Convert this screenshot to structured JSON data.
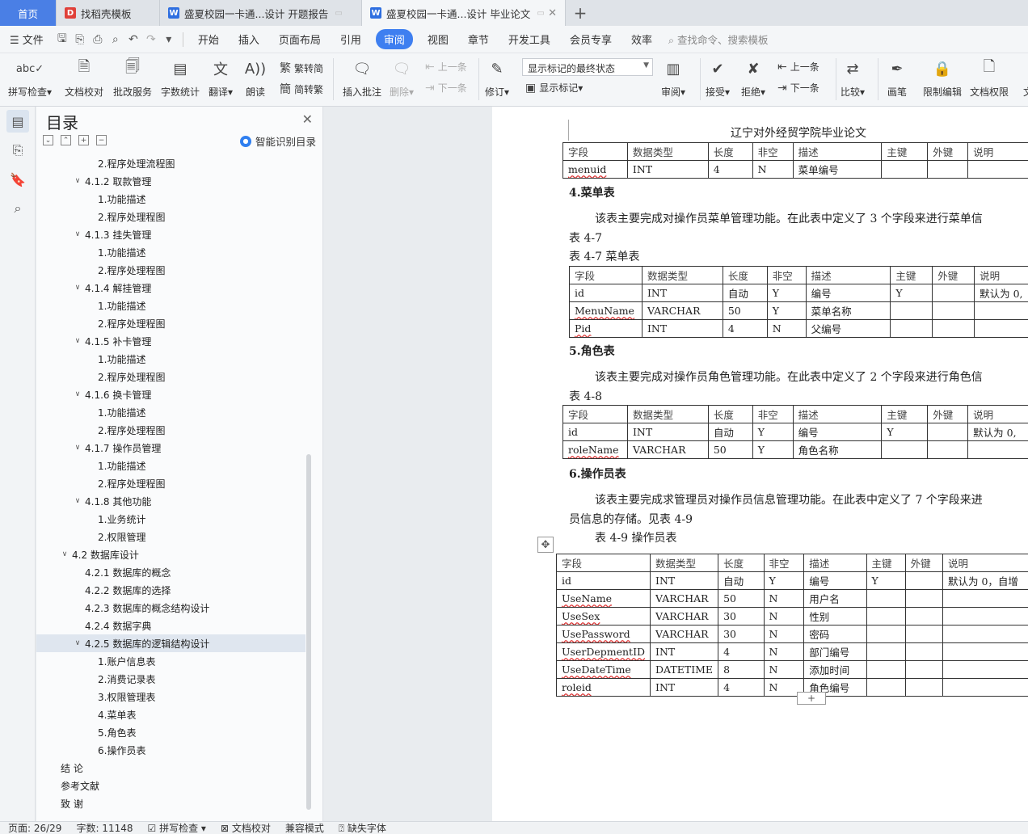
{
  "tabs": {
    "home": "首页",
    "t1": "找稻壳模板",
    "t2": "盛夏校园一卡通...设计 开题报告",
    "t3": "盛夏校园一卡通...设计 毕业论文"
  },
  "menu": {
    "file": "文件",
    "items": [
      "开始",
      "插入",
      "页面布局",
      "引用",
      "审阅",
      "视图",
      "章节",
      "开发工具",
      "会员专享",
      "效率"
    ],
    "search": "查找命令、搜索模板"
  },
  "ribbon": {
    "spell": "拼写检查",
    "doc_check": "文档校对",
    "batch": "批改服务",
    "word_count": "字数统计",
    "translate": "翻译",
    "read": "朗读",
    "trad": "繁转简",
    "simp": "简转繁",
    "insert_comment": "插入批注",
    "delete": "删除",
    "prev": "上一条",
    "next": "下一条",
    "revise": "修订",
    "state": "显示标记的最终状态",
    "show_marks": "显示标记",
    "review": "审阅",
    "accept": "接受",
    "reject": "拒绝",
    "prev2": "上一条",
    "next2": "下一条",
    "compare": "比较",
    "pen": "画笔",
    "restrict": "限制编辑",
    "doc_perm": "文档权限",
    "more": "文"
  },
  "toc": {
    "title": "目录",
    "ai": "智能识别目录",
    "items": [
      {
        "text": "2.程序处理流程图",
        "level": 3
      },
      {
        "text": "4.1.2  取款管理",
        "level": 2,
        "caret": true
      },
      {
        "text": "1.功能描述",
        "level": 3
      },
      {
        "text": "2.程序处理程图",
        "level": 3
      },
      {
        "text": "4.1.3  挂失管理",
        "level": 2,
        "caret": true
      },
      {
        "text": "1.功能描述",
        "level": 3
      },
      {
        "text": "2.程序处理程图",
        "level": 3
      },
      {
        "text": "4.1.4  解挂管理",
        "level": 2,
        "caret": true
      },
      {
        "text": "1.功能描述",
        "level": 3
      },
      {
        "text": "2.程序处理程图",
        "level": 3
      },
      {
        "text": "4.1.5  补卡管理",
        "level": 2,
        "caret": true
      },
      {
        "text": "1.功能描述",
        "level": 3
      },
      {
        "text": "2.程序处理程图",
        "level": 3
      },
      {
        "text": "4.1.6  换卡管理",
        "level": 2,
        "caret": true
      },
      {
        "text": "1.功能描述",
        "level": 3
      },
      {
        "text": "2.程序处理程图",
        "level": 3
      },
      {
        "text": "4.1.7  操作员管理",
        "level": 2,
        "caret": true
      },
      {
        "text": "1.功能描述",
        "level": 3
      },
      {
        "text": "2.程序处理程图",
        "level": 3
      },
      {
        "text": "4.1.8  其他功能",
        "level": 2,
        "caret": true
      },
      {
        "text": "1.业务统计",
        "level": 3
      },
      {
        "text": "2.权限管理",
        "level": 3
      },
      {
        "text": "4.2  数据库设计",
        "level": 1,
        "caret": true
      },
      {
        "text": "4.2.1  数据库的概念",
        "level": 2
      },
      {
        "text": "4.2.2  数据库的选择",
        "level": 2
      },
      {
        "text": "4.2.3  数据库的概念结构设计",
        "level": 2
      },
      {
        "text": "4.2.4  数据字典",
        "level": 2
      },
      {
        "text": "4.2.5  数据库的逻辑结构设计",
        "level": 2,
        "caret": true,
        "selected": true
      },
      {
        "text": "1.账户信息表",
        "level": 3
      },
      {
        "text": "2.消费记录表",
        "level": 3
      },
      {
        "text": "3.权限管理表",
        "level": 3
      },
      {
        "text": "4.菜单表",
        "level": 3
      },
      {
        "text": "5.角色表",
        "level": 3
      },
      {
        "text": "6.操作员表",
        "level": 3
      },
      {
        "text": "结    论",
        "level": 0
      },
      {
        "text": "参考文献",
        "level": 0
      },
      {
        "text": "致    谢",
        "level": 0
      }
    ]
  },
  "doc": {
    "header": "辽宁对外经贸学院毕业论文",
    "cols": [
      "字段",
      "数据类型",
      "长度",
      "非空",
      "描述",
      "主键",
      "外键",
      "说明"
    ],
    "t0_rows": [
      [
        "menuid",
        "INT",
        "4",
        "N",
        "菜单编号",
        "",
        "",
        ""
      ]
    ],
    "s4_title": "4.菜单表",
    "s4_para": "该表主要完成对操作员菜单管理功能。在此表中定义了 3 个字段来进行菜单信",
    "s4_ref": "表 4-7",
    "s4_caption": "表 4-7 菜单表",
    "t47_rows": [
      [
        "id",
        "INT",
        "自动",
        "Y",
        "编号",
        "Y",
        "",
        "默认为 0,"
      ],
      [
        "MenuName",
        "VARCHAR",
        "50",
        "Y",
        "菜单名称",
        "",
        "",
        ""
      ],
      [
        "Pid",
        "INT",
        "4",
        "N",
        "父编号",
        "",
        "",
        ""
      ]
    ],
    "s5_title": "5.角色表",
    "s5_para": "该表主要完成对操作员角色管理功能。在此表中定义了 2 个字段来进行角色信",
    "s5_ref": "表 4-8",
    "t48_rows": [
      [
        "id",
        "INT",
        "自动",
        "Y",
        "编号",
        "Y",
        "",
        "默认为 0,"
      ],
      [
        "roleName",
        "VARCHAR",
        "50",
        "Y",
        "角色名称",
        "",
        "",
        ""
      ]
    ],
    "s6_title": "6.操作员表",
    "s6_para1": "该表主要完成求管理员对操作员信息管理功能。在此表中定义了 7 个字段来进",
    "s6_para2": "员信息的存储。见表 4-9",
    "s6_caption": "表 4-9 操作员表",
    "t49_rows": [
      [
        "id",
        "INT",
        "自动",
        "Y",
        "编号",
        "Y",
        "",
        "默认为 0，自增"
      ],
      [
        "UseName",
        "VARCHAR",
        "50",
        "N",
        "用户名",
        "",
        "",
        ""
      ],
      [
        "UseSex",
        "VARCHAR",
        "30",
        "N",
        "性别",
        "",
        "",
        ""
      ],
      [
        "UsePassword",
        "VARCHAR",
        "30",
        "N",
        "密码",
        "",
        "",
        ""
      ],
      [
        "UserDepmentID",
        "INT",
        "4",
        "N",
        "部门编号",
        "",
        "",
        ""
      ],
      [
        "UseDateTime",
        "DATETIME",
        "8",
        "N",
        "添加时间",
        "",
        "",
        ""
      ],
      [
        "roleid",
        "INT",
        "4",
        "N",
        "角色编号",
        "",
        "",
        ""
      ]
    ]
  },
  "status": {
    "page": "页面: 26/29",
    "words": "字数: 11148",
    "spell": "拼写检查",
    "doc_check": "文档校对",
    "compat": "兼容模式",
    "missing_font": "缺失字体"
  }
}
